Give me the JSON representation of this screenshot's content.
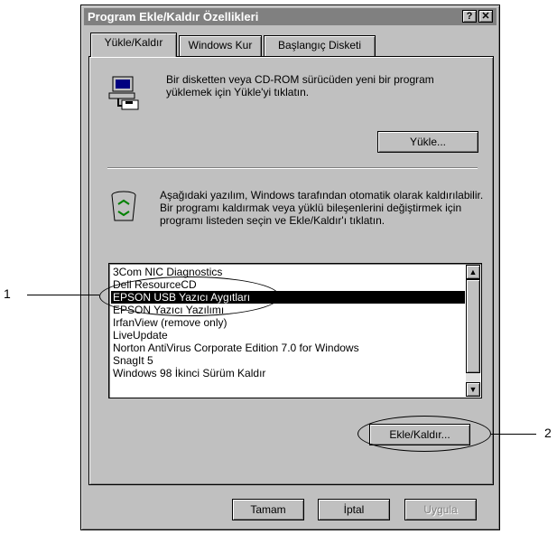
{
  "window": {
    "title": "Program Ekle/Kaldır Özellikleri",
    "help_label": "?",
    "close_label": "✕"
  },
  "tabs": [
    {
      "label": "Yükle/Kaldır",
      "active": true
    },
    {
      "label": "Windows Kur",
      "active": false
    },
    {
      "label": "Başlangıç Disketi",
      "active": false
    }
  ],
  "install": {
    "icon": "install-computer-icon",
    "text": "Bir disketten veya CD-ROM sürücüden yeni bir program yüklemek için Yükle'yi tıklatın.",
    "button_label": "Yükle..."
  },
  "remove": {
    "icon": "recycle-bin-icon",
    "text": "Aşağıdaki yazılım, Windows tarafından otomatik olarak kaldırılabilir. Bir programı kaldırmak veya yüklü bileşenlerini değiştirmek için programı listeden seçin ve Ekle/Kaldır'ı tıklatın."
  },
  "programs": [
    "3Com NIC Diagnostics",
    "Dell ResourceCD",
    "EPSON USB Yazıcı Aygıtları",
    "EPSON Yazıcı Yazılımı",
    "IrfanView (remove only)",
    "LiveUpdate",
    "Norton AntiVirus Corporate Edition 7.0 for Windows",
    "SnagIt 5",
    "Windows 98 İkinci Sürüm Kaldır"
  ],
  "selected_program": "EPSON USB Yazıcı Aygıtları",
  "add_remove_button": "Ekle/Kaldır...",
  "footer": {
    "ok": "Tamam",
    "cancel": "İptal",
    "apply": "Uygula"
  },
  "callouts": {
    "one": "1",
    "two": "2"
  }
}
